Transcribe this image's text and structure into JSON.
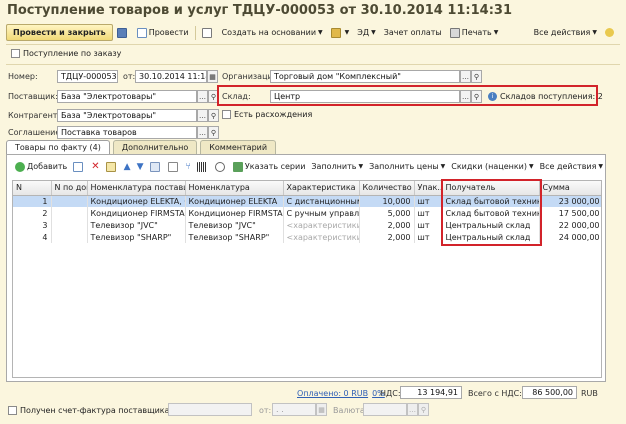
{
  "window": {
    "title": "Поступление товаров и услуг ТДЦУ-000053 от 30.10.2014 11:14:31"
  },
  "toolbar": {
    "post_and_close": "Провести и закрыть",
    "post": "Провести",
    "create_based_on": "Создать на основании",
    "ed": "ЭД",
    "invoice_for_payment": "Зачет оплаты",
    "print": "Печать",
    "all_actions": "Все действия"
  },
  "header": {
    "by_order_label": "Поступление по заказу",
    "number_label": "Номер:",
    "number_value": "ТДЦУ-000053",
    "date_label": "от:",
    "date_value": "30.10.2014 11:14:31",
    "organization_label": "Организация:",
    "organization_value": "Торговый дом \"Комплексный\"",
    "supplier_label": "Поставщик:",
    "supplier_value": "База \"Электротовары\"",
    "warehouse_label": "Склад:",
    "warehouse_value": "Центр",
    "warehouses_info": "Складов поступления: 2",
    "counterparty_label": "Контрагент:",
    "counterparty_value": "База \"Электротовары\"",
    "discrepancies_label": "Есть расхождения",
    "agreement_label": "Соглашение:",
    "agreement_value": "Поставка товаров"
  },
  "tabs": [
    {
      "label": "Товары по факту (4)"
    },
    {
      "label": "Дополнительно"
    },
    {
      "label": "Комментарий"
    }
  ],
  "goods_toolbar": {
    "add": "Добавить",
    "specify_series": "Указать серии",
    "fill": "Заполнить",
    "fill_prices": "Заполнить цены",
    "discounts": "Скидки (наценки)",
    "all_actions": "Все действия"
  },
  "table": {
    "columns": [
      "N",
      "N по док.",
      "Номенклатура поставщ...",
      "Номенклатура",
      "Характеристика",
      "Количество",
      "Упак...",
      "Получатель",
      "Сумма"
    ],
    "rows": [
      {
        "n": "1",
        "doc_n": "",
        "supplier_item": "Кондиционер ELEKTA, С...",
        "item": "Кондиционер ELEKTA",
        "characteristic": "С дистанционным...",
        "quantity": "10,000",
        "unit": "шт",
        "recipient": "Склад бытовой техники",
        "sum": "23 000,00"
      },
      {
        "n": "2",
        "doc_n": "",
        "supplier_item": "Кондиционер FIRMSTAR...",
        "item": "Кондиционер FIRMSTA...",
        "characteristic": "С ручным управл...",
        "quantity": "5,000",
        "unit": "шт",
        "recipient": "Склад бытовой техники",
        "sum": "17 500,00"
      },
      {
        "n": "3",
        "doc_n": "",
        "supplier_item": "Телевизор \"JVC\"",
        "item": "Телевизор \"JVC\"",
        "characteristic": "<характеристики ...",
        "quantity": "2,000",
        "unit": "шт",
        "recipient": "Центральный склад",
        "sum": "22 000,00"
      },
      {
        "n": "4",
        "doc_n": "",
        "supplier_item": "Телевизор \"SHARP\"",
        "item": "Телевизор \"SHARP\"",
        "characteristic": "<характеристики ...",
        "quantity": "2,000",
        "unit": "шт",
        "recipient": "Центральный склад",
        "sum": "24 000,00"
      }
    ]
  },
  "totals": {
    "paid": "Оплачено: 0 RUB",
    "paid_percent": "0%",
    "vat_label": "НДС:",
    "vat_value": "13 194,91",
    "total_label": "Всего с НДС:",
    "total_value": "86 500,00",
    "currency": "RUB"
  },
  "invoice": {
    "received_label": "Получен счет-фактура поставщика N:",
    "from_label": "от:",
    "date_placeholder": ". .",
    "currency_label": "Валюта:"
  },
  "colors": {
    "background": "#fbf6de",
    "highlight": "#d2232a",
    "selection": "#c4daf5"
  }
}
